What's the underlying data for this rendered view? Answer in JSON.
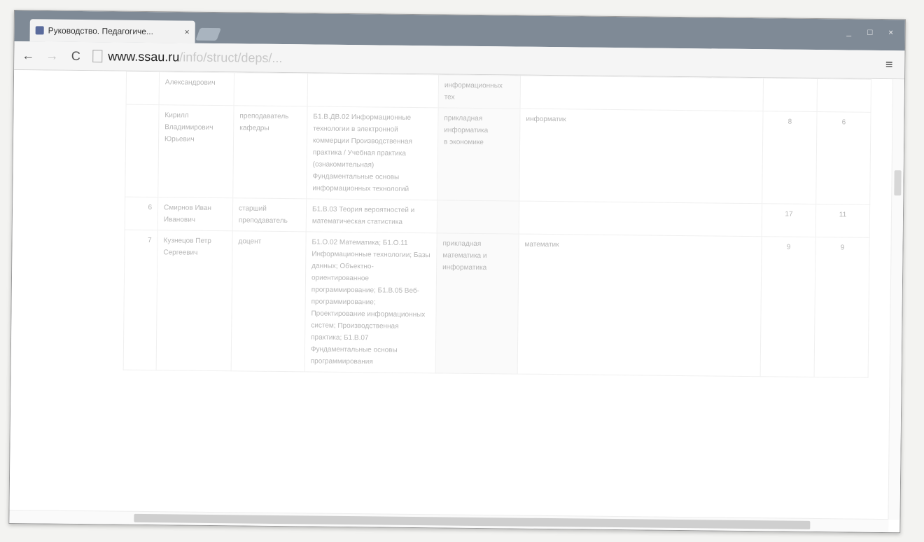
{
  "browser": {
    "tab_title": "Руководство. Педагогиче...",
    "tab_close": "×",
    "url_host": "www.ssau.ru",
    "url_path": "/info/struct/deps/...",
    "menu_icon": "hamburger-icon",
    "window_controls": [
      "_",
      "□",
      "×"
    ]
  },
  "table": {
    "rows": [
      {
        "num": "",
        "name": "Александрович",
        "position": "",
        "disciplines": "",
        "education": "информационных\nтех",
        "qualification": "",
        "exp1": "",
        "exp2": ""
      },
      {
        "num": "",
        "name": "Кирилл\nВладимирович\nЮрьевич",
        "position": "преподаватель\nкафедры",
        "disciplines": "Б1.В.ДВ.02 Информационные технологии в электронной коммерции Производственная практика / Учебная практика (ознакомительная) Фундаментальные основы информационных технологий",
        "education": "прикладная\nинформатика\nв экономике",
        "qualification": "информатик",
        "exp1": "8",
        "exp2": "6"
      },
      {
        "num": "6",
        "name": "Смирнов Иван\nИванович",
        "position": "старший\nпреподаватель",
        "disciplines": "Б1.В.03 Теория вероятностей и математическая статистика",
        "education": "",
        "qualification": "",
        "exp1": "17",
        "exp2": "11"
      },
      {
        "num": "7",
        "name": "Кузнецов Петр\nСергеевич",
        "position": "доцент",
        "disciplines": "Б1.О.02 Математика; Б1.О.11 Информационные технологии; Базы данных; Объектно-ориентированное программирование; Б1.В.05 Веб-программирование; Проектирование информационных систем; Производственная практика; Б1.В.07 Фундаментальные основы программирования",
        "education": "прикладная\nматематика и\nинформатика",
        "qualification": "математик",
        "exp1": "9",
        "exp2": "9"
      }
    ]
  }
}
